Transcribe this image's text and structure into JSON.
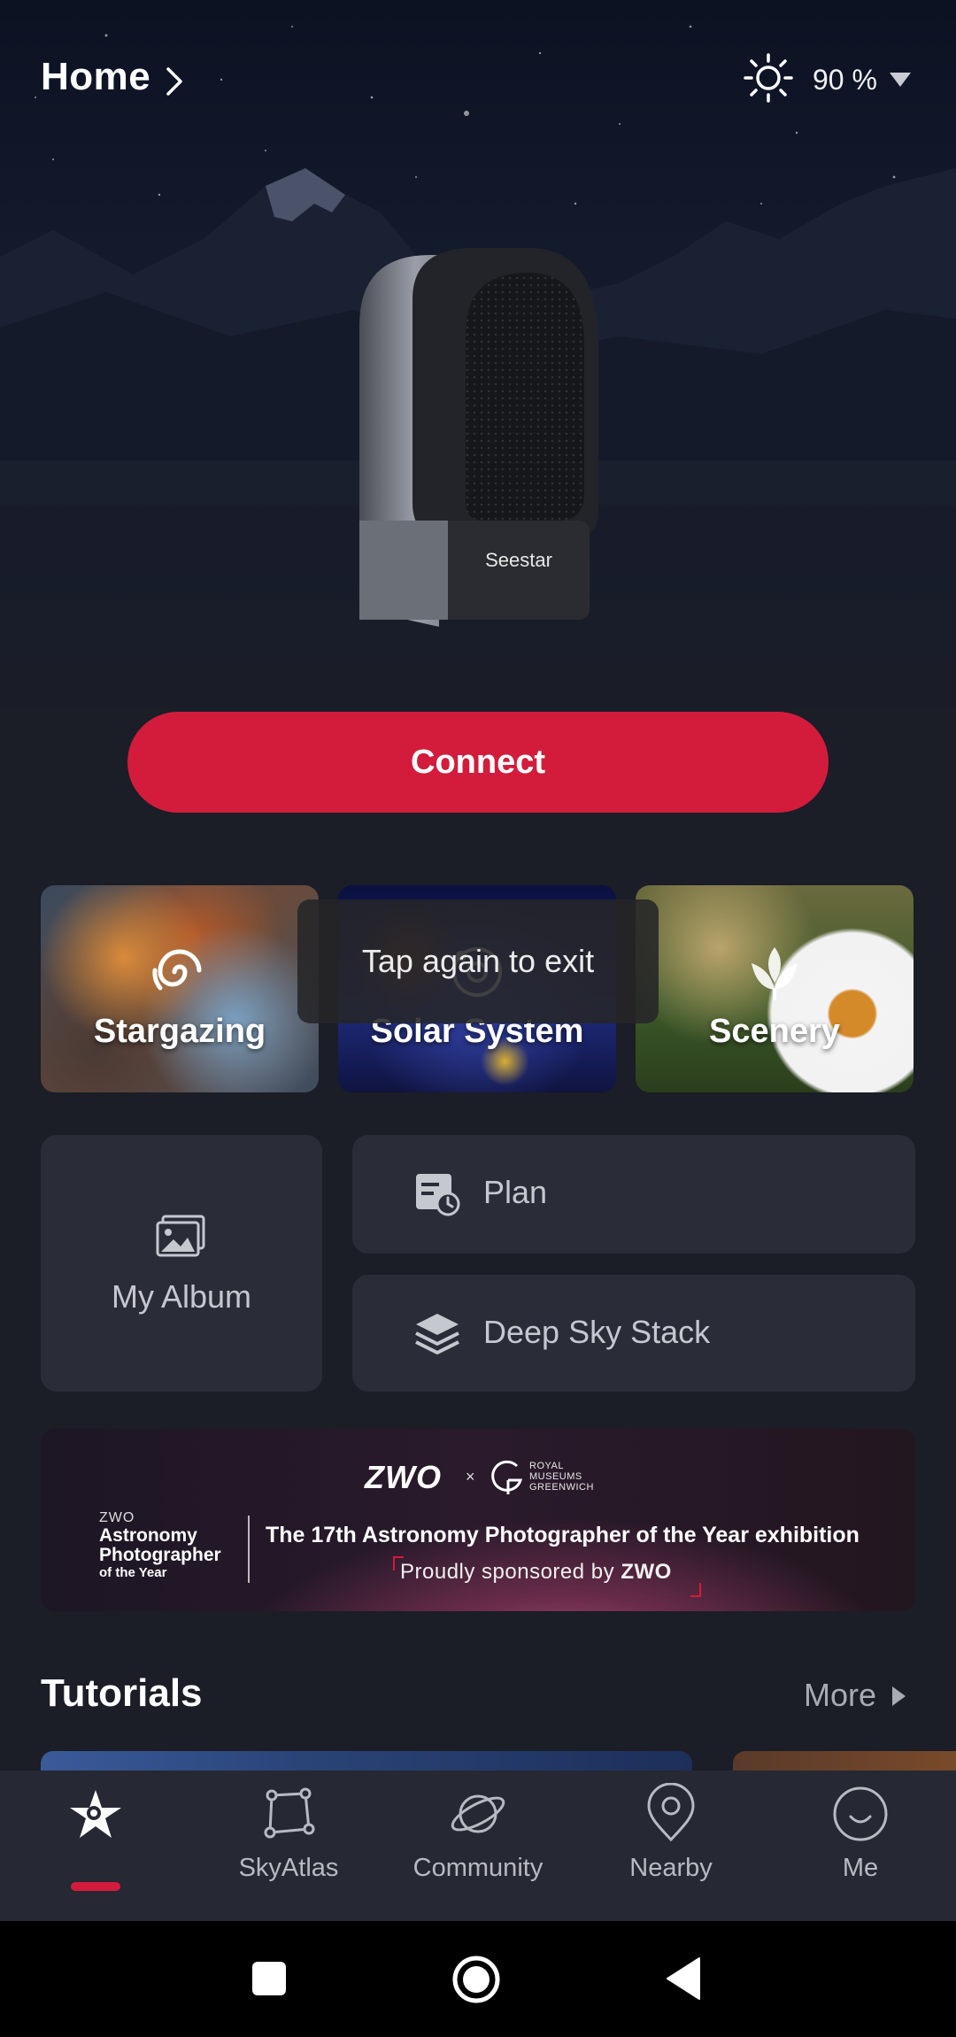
{
  "header": {
    "title": "Home",
    "brightness_value": "90 %"
  },
  "device": {
    "brand": "Seestar"
  },
  "connect_label": "Connect",
  "modes": [
    {
      "label": "Stargazing"
    },
    {
      "label": "Solar System"
    },
    {
      "label": "Scenery"
    }
  ],
  "toast": "Tap again to exit",
  "tools": {
    "album": "My Album",
    "plan": "Plan",
    "stack": "Deep Sky Stack"
  },
  "banner": {
    "zwo_logo": "ZWO",
    "x": "×",
    "rmg_line1": "ROYAL",
    "rmg_line2": "MUSEUMS",
    "rmg_line3": "GREENWICH",
    "apy_small": "ZWO",
    "apy_line1": "Astronomy",
    "apy_line2": "Photographer",
    "apy_line3": "of the Year",
    "headline": "The 17th Astronomy Photographer of the Year exhibition",
    "sub_prefix": "Proudly sponsored by ",
    "sub_brand": "ZWO"
  },
  "tutorials": {
    "title": "Tutorials",
    "more": "More"
  },
  "nav": [
    {
      "label": "",
      "icon": "stargazing-icon",
      "active": true
    },
    {
      "label": "SkyAtlas",
      "icon": "sky-atlas-icon"
    },
    {
      "label": "Community",
      "icon": "planet-icon"
    },
    {
      "label": "Nearby",
      "icon": "location-pin-icon"
    },
    {
      "label": "Me",
      "icon": "smiley-icon"
    }
  ],
  "colors": {
    "accent": "#d31c3b",
    "background": "#1b1d27",
    "tile": "#2a2c38"
  }
}
